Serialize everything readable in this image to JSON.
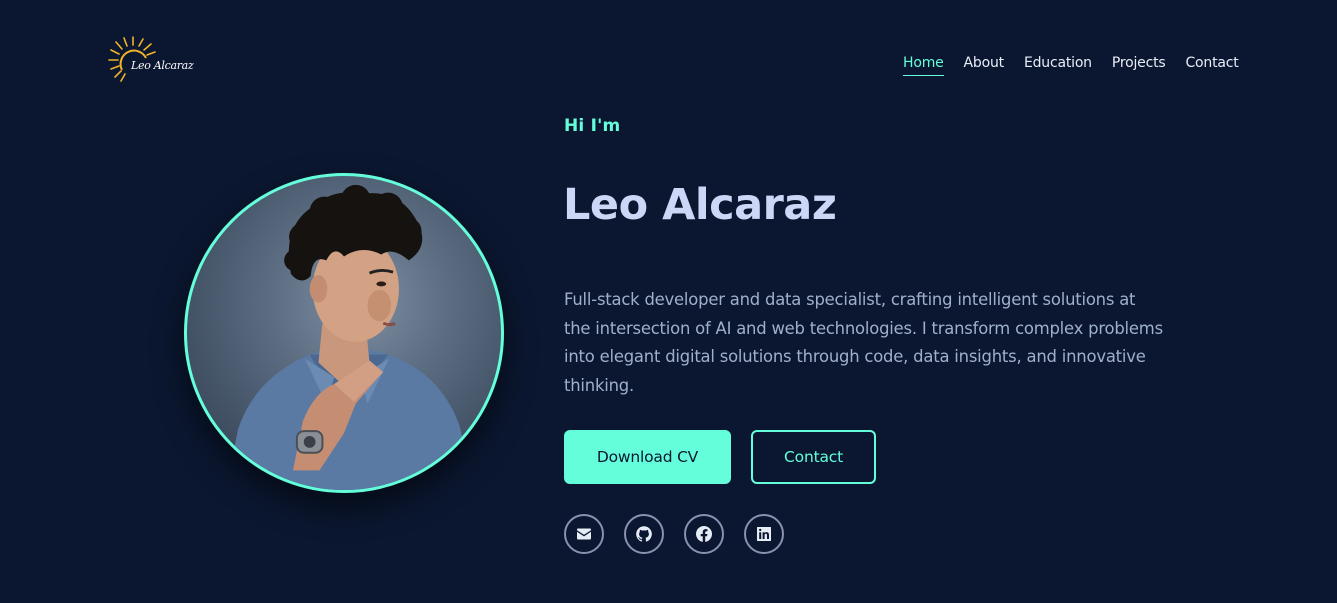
{
  "logo": {
    "text": "Leo Alcaraz",
    "sun_color": "#f0b429"
  },
  "nav": {
    "items": [
      {
        "label": "Home",
        "active": true
      },
      {
        "label": "About",
        "active": false
      },
      {
        "label": "Education",
        "active": false
      },
      {
        "label": "Projects",
        "active": false
      },
      {
        "label": "Contact",
        "active": false
      }
    ]
  },
  "hero": {
    "greeting": "Hi I'm",
    "name": "Leo Alcaraz",
    "description": "Full-stack developer and data specialist, crafting intelligent solutions at the intersection of AI and web technologies. I transform complex problems into elegant digital solutions through code, data insights, and innovative thinking.",
    "buttons": {
      "download_cv": "Download CV",
      "contact": "Contact"
    },
    "socials": [
      "envelope-icon",
      "github-icon",
      "facebook-icon",
      "linkedin-icon"
    ]
  },
  "colors": {
    "background": "#0b1730",
    "accent": "#64ffda",
    "heading": "#ccd6f6",
    "body_text": "#9fb0cc"
  }
}
